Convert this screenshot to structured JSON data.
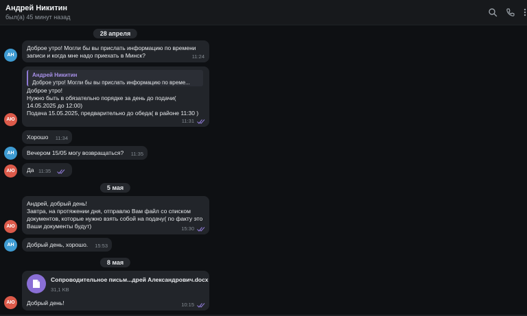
{
  "header": {
    "contact_name": "Андрей Никитин",
    "status": "был(а) 45 минут назад",
    "icons": [
      "search-icon",
      "phone-icon",
      "more-icon"
    ]
  },
  "avatars": {
    "ah": "АН",
    "ayu": "АЮ"
  },
  "dates": {
    "d1": "28 апреля",
    "d2": "5 мая",
    "d3": "8 мая"
  },
  "messages": {
    "m1": {
      "text": "Доброе утро! Могли бы вы прислать информацию по времени\nзаписи и когда мне надо приехать в Минск?",
      "time": "11:24"
    },
    "m2": {
      "quote_author": "Андрей Никитин",
      "quote_text": "Доброе утро! Могли бы вы прислать информацию по време...",
      "text": "Доброе утро!\nНужно быть в обязательно порядке за день до подачи(\n14.05.2025 до 12:00)\nПодача 15.05.2025, предварительно до обеда( в районе 11:30 )",
      "time": "11:31"
    },
    "m3": {
      "text": "Хорошо",
      "time": "11:34"
    },
    "m4": {
      "text": "Вечером 15/05 могу возвращаться?",
      "time": "11:35"
    },
    "m5": {
      "text": "Да",
      "time": "11:35"
    },
    "m6": {
      "text": "Андрей, добрый день!\nЗавтра, на протяжении дня, отправлю Вам файл со списком\nдокументов, которые нужно взять собой на подачу( по факту это\nВаши документы будут)",
      "time": "15:30"
    },
    "m7": {
      "text": "Добрый день, хорошо.",
      "time": "15:53"
    },
    "m8": {
      "file_name": "Сопроводительное письм...дрей Александрович.docx",
      "file_size": "31,1 KB",
      "text": "Добрый день!",
      "time": "10:15"
    }
  },
  "colors": {
    "accent": "#8a6fd6",
    "avatar_ah": "#3e9bd2",
    "avatar_ayu": "#dc5a4a",
    "bubble": "#22252a",
    "background": "#0e1013"
  }
}
